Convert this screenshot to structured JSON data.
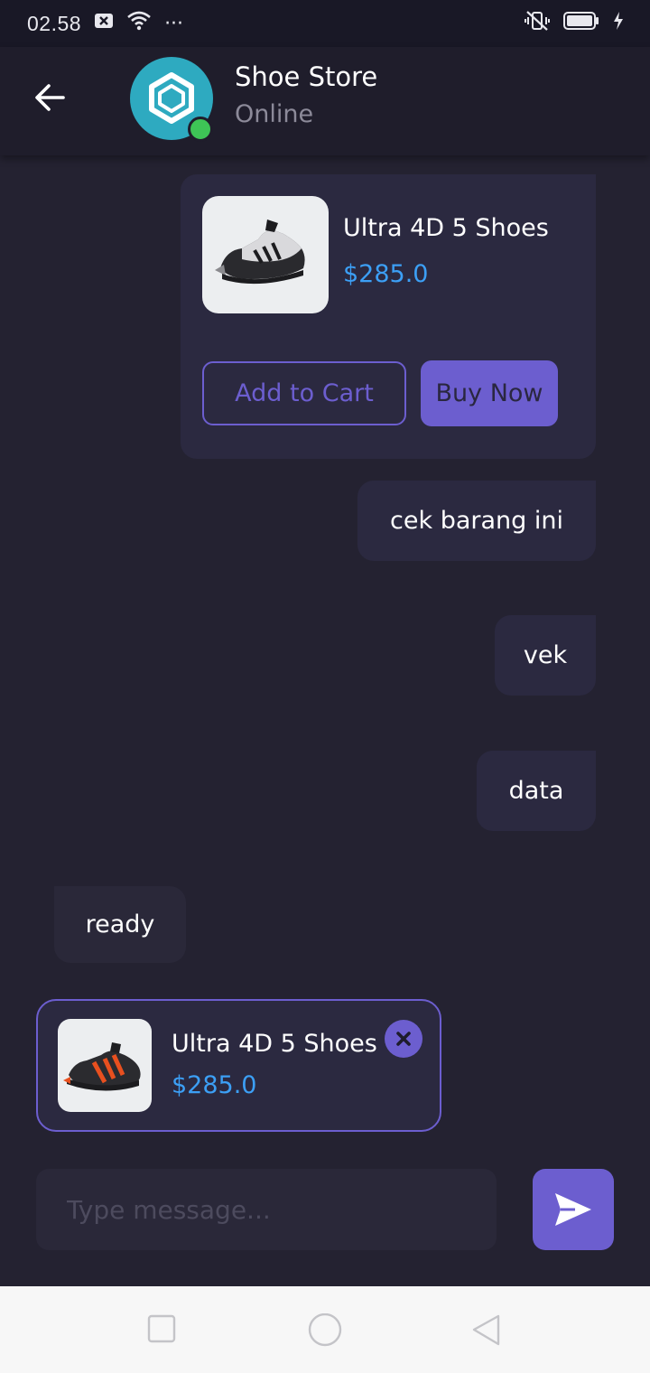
{
  "status_bar": {
    "time": "02.58",
    "overflow": "···"
  },
  "header": {
    "title": "Shoe Store",
    "status": "Online"
  },
  "messages": [
    {
      "text": "cek barang ini"
    },
    {
      "text": "vek"
    },
    {
      "text": "data"
    },
    {
      "text": "ready"
    }
  ],
  "product_message": {
    "name": "Ultra 4D 5 Shoes",
    "price": "$285.0",
    "add_to_cart_label": "Add to Cart",
    "buy_now_label": "Buy Now"
  },
  "product_preview": {
    "name": "Ultra 4D 5 Shoes",
    "price": "$285.0"
  },
  "composer": {
    "placeholder": "Type message..."
  },
  "colors": {
    "background": "#242231",
    "accent": "#6c5ecf",
    "price": "#3c9ff5",
    "online": "#3ec456",
    "avatar": "#2eaac0"
  },
  "icons": {
    "back": "arrow-left-icon",
    "send": "send-icon",
    "close": "close-icon",
    "nav": [
      "square-icon",
      "circle-icon",
      "triangle-back-icon"
    ]
  }
}
